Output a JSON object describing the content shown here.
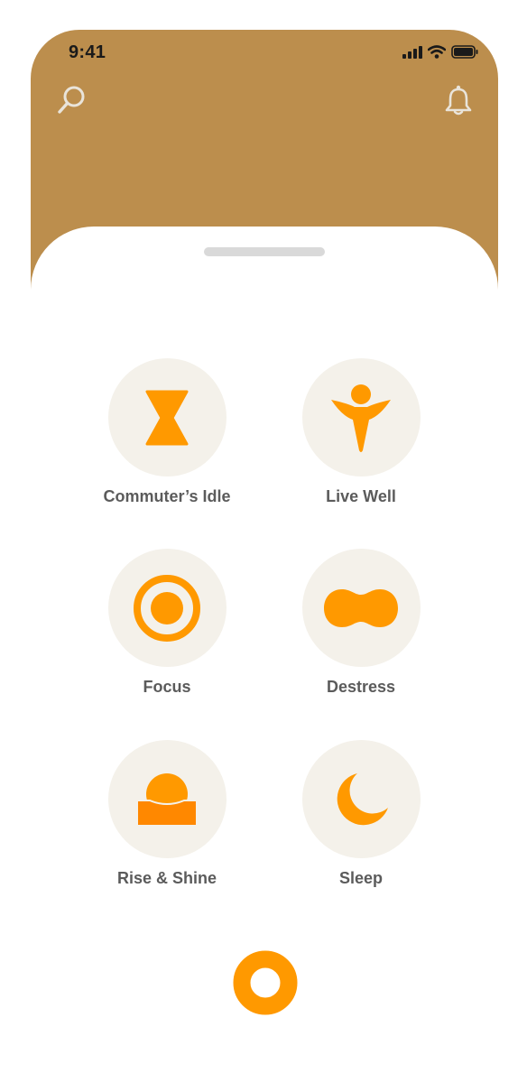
{
  "status_bar": {
    "time": "9:41",
    "icons": [
      "signal-icon",
      "wifi-icon",
      "battery-icon"
    ]
  },
  "header": {
    "background_color": "#bc8e4d",
    "left_icon": "search-icon",
    "right_icon": "bell-icon"
  },
  "categories": [
    {
      "label": "Commuter’s Idle",
      "icon": "hourglass-icon"
    },
    {
      "label": "Live Well",
      "icon": "person-icon"
    },
    {
      "label": "Focus",
      "icon": "target-icon"
    },
    {
      "label": "Destress",
      "icon": "blob-icon"
    },
    {
      "label": "Rise & Shine",
      "icon": "sunrise-icon"
    },
    {
      "label": "Sleep",
      "icon": "moon-icon"
    }
  ],
  "colors": {
    "accent": "#ff9900",
    "circle_bg": "#f4f1ea",
    "label": "#5b5b5b"
  },
  "bottom_action": {
    "icon": "ring-icon"
  }
}
